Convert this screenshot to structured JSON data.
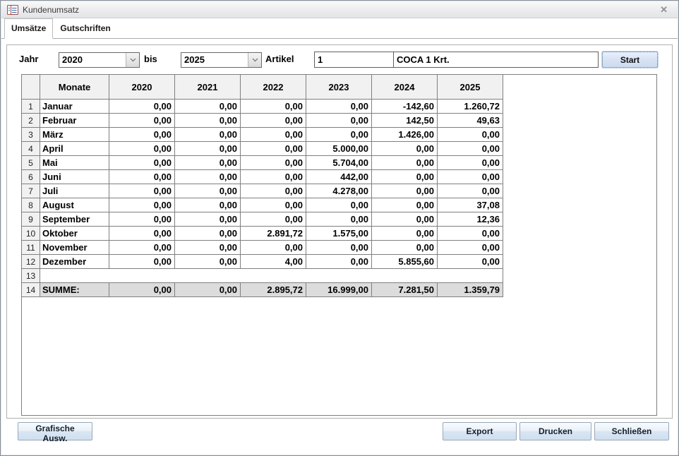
{
  "window": {
    "title": "Kundenumsatz",
    "close_glyph": "✕"
  },
  "tabs": [
    {
      "label": "Umsätze",
      "active": true
    },
    {
      "label": "Gutschriften",
      "active": false
    }
  ],
  "filters": {
    "jahr_label": "Jahr",
    "jahr_von": "2020",
    "bis_label": "bis",
    "jahr_bis": "2025",
    "artikel_label": "Artikel",
    "artikel_nr": "1",
    "artikel_name": "COCA 1 Krt.",
    "start_label": "Start"
  },
  "table": {
    "columns": [
      "",
      "Monate",
      "2020",
      "2021",
      "2022",
      "2023",
      "2024",
      "2025"
    ],
    "rows": [
      {
        "num": "1",
        "monat": "Januar",
        "values": [
          "0,00",
          "0,00",
          "0,00",
          "0,00",
          "-142,60",
          "1.260,72"
        ]
      },
      {
        "num": "2",
        "monat": "Februar",
        "values": [
          "0,00",
          "0,00",
          "0,00",
          "0,00",
          "142,50",
          "49,63"
        ]
      },
      {
        "num": "3",
        "monat": "März",
        "values": [
          "0,00",
          "0,00",
          "0,00",
          "0,00",
          "1.426,00",
          "0,00"
        ]
      },
      {
        "num": "4",
        "monat": "April",
        "values": [
          "0,00",
          "0,00",
          "0,00",
          "5.000,00",
          "0,00",
          "0,00"
        ]
      },
      {
        "num": "5",
        "monat": "Mai",
        "values": [
          "0,00",
          "0,00",
          "0,00",
          "5.704,00",
          "0,00",
          "0,00"
        ]
      },
      {
        "num": "6",
        "monat": "Juni",
        "values": [
          "0,00",
          "0,00",
          "0,00",
          "442,00",
          "0,00",
          "0,00"
        ]
      },
      {
        "num": "7",
        "monat": "Juli",
        "values": [
          "0,00",
          "0,00",
          "0,00",
          "4.278,00",
          "0,00",
          "0,00"
        ]
      },
      {
        "num": "8",
        "monat": "August",
        "values": [
          "0,00",
          "0,00",
          "0,00",
          "0,00",
          "0,00",
          "37,08"
        ]
      },
      {
        "num": "9",
        "monat": "September",
        "values": [
          "0,00",
          "0,00",
          "0,00",
          "0,00",
          "0,00",
          "12,36"
        ]
      },
      {
        "num": "10",
        "monat": "Oktober",
        "values": [
          "0,00",
          "0,00",
          "2.891,72",
          "1.575,00",
          "0,00",
          "0,00"
        ]
      },
      {
        "num": "11",
        "monat": "November",
        "values": [
          "0,00",
          "0,00",
          "0,00",
          "0,00",
          "0,00",
          "0,00"
        ]
      },
      {
        "num": "12",
        "monat": "Dezember",
        "values": [
          "0,00",
          "0,00",
          "4,00",
          "0,00",
          "5.855,60",
          "0,00"
        ]
      },
      {
        "num": "13",
        "monat": "",
        "values": [
          "",
          "",
          "",
          "",
          "",
          ""
        ],
        "empty": true
      },
      {
        "num": "14",
        "monat": "SUMME:",
        "values": [
          "0,00",
          "0,00",
          "2.895,72",
          "16.999,00",
          "7.281,50",
          "1.359,79"
        ],
        "sum": true
      }
    ]
  },
  "footer": {
    "grafische_label": "Grafische Ausw.",
    "export_label": "Export",
    "drucken_label": "Drucken",
    "schliessen_label": "Schließen"
  },
  "colors": {
    "button_face": "#d7e3f4",
    "grid_line": "#7f7f7f",
    "sum_row_bg": "#dcdcdc",
    "header_cell_bg": "#f1f1f1"
  }
}
